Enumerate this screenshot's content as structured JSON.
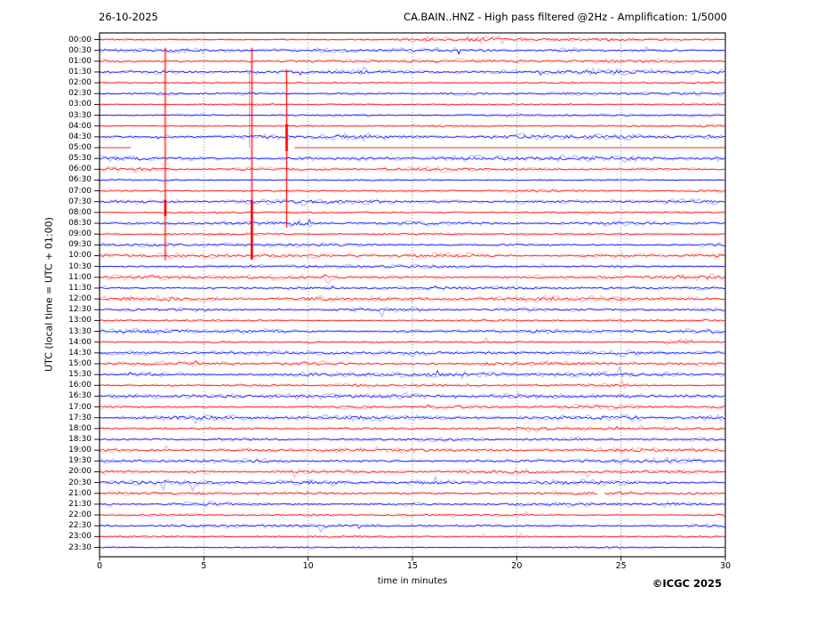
{
  "header": {
    "date": "26-10-2025",
    "title": "CA.BAIN..HNZ - High pass filtered @2Hz - Amplification: 1/5000"
  },
  "footer": {
    "copyright": "©ICGC 2025"
  },
  "chart_data": {
    "type": "line",
    "subtype": "helicorder_dayplot_seismogram",
    "date": "26-10-2025",
    "station": "CA.BAIN..HNZ",
    "filter": "High pass filtered @2Hz",
    "amplification": "1/5000",
    "title": "CA.BAIN..HNZ - High pass filtered @2Hz - Amplification: 1/5000",
    "xlabel": "time in minutes",
    "ylabel": "UTC (local time = UTC + 01:00)",
    "xlim": [
      0,
      30
    ],
    "x_ticks": [
      0,
      5,
      10,
      15,
      20,
      25,
      30
    ],
    "minutes_per_row": 30,
    "grid": {
      "vertical_interval_minutes": 5,
      "style": "dotted",
      "color": "#777777"
    },
    "row_labels": [
      "00:00",
      "00:30",
      "01:00",
      "01:30",
      "02:00",
      "02:30",
      "03:00",
      "03:30",
      "04:00",
      "04:30",
      "05:00",
      "05:30",
      "06:00",
      "06:30",
      "07:00",
      "07:30",
      "08:00",
      "08:30",
      "09:00",
      "09:30",
      "10:00",
      "10:30",
      "11:00",
      "11:30",
      "12:00",
      "12:30",
      "13:00",
      "13:30",
      "14:00",
      "14:30",
      "15:00",
      "15:30",
      "16:00",
      "16:30",
      "17:00",
      "17:30",
      "18:00",
      "18:30",
      "19:00",
      "19:30",
      "20:00",
      "20:30",
      "21:00",
      "21:30",
      "22:00",
      "22:30",
      "23:00",
      "23:30"
    ],
    "trace_colors": {
      "on_hour": "#ff0000",
      "on_half_hour": "#0000ff"
    },
    "axis_color": "#000000",
    "events": [
      {
        "x_minutes": 3.15,
        "color": "#ff0000",
        "from_row": "00:30",
        "to_row": "10:00",
        "core_from_row": "07:30",
        "core_to_row": "08:00"
      },
      {
        "x_minutes": 7.3,
        "color": "#ff0000",
        "from_row": "00:30",
        "to_row": "10:00",
        "core_from_row": "07:30",
        "core_to_row": "10:00",
        "secondary": {
          "x_minutes": 7.18,
          "from_row": "01:30",
          "to_row": "05:00"
        }
      },
      {
        "x_minutes": 8.97,
        "color": "#ff0000",
        "from_row": "01:30",
        "to_row": "08:30",
        "core_from_row": "04:00",
        "core_to_row": "05:00"
      }
    ],
    "flat_rows": [
      {
        "row": "05:00",
        "visible_segments_minutes": [
          [
            0,
            1.5
          ],
          [
            9.35,
            30
          ]
        ]
      }
    ],
    "trace_gaps": [
      {
        "row": "21:00",
        "x_minutes": [
          23.9,
          24.2
        ]
      }
    ],
    "noise_bursts": [
      {
        "row": "00:00",
        "x_minutes": [
          14.0,
          19.5
        ],
        "amplitude": 1.6
      },
      {
        "row": "08:30",
        "x_minutes": [
          9.1,
          10.2
        ],
        "amplitude": 2.0
      },
      {
        "row": "11:00",
        "x_minutes": [
          10.8,
          11.05
        ],
        "amplitude": 3.2
      },
      {
        "row": "14:00",
        "x_minutes": [
          27.0,
          28.4
        ],
        "amplitude": 2.3
      },
      {
        "row": "18:00",
        "x_minutes": [
          20.5,
          24.5
        ],
        "amplitude": 1.6
      },
      {
        "row": "19:00",
        "x_minutes": [
          0.0,
          30.0
        ],
        "amplitude": 1.4
      }
    ]
  }
}
